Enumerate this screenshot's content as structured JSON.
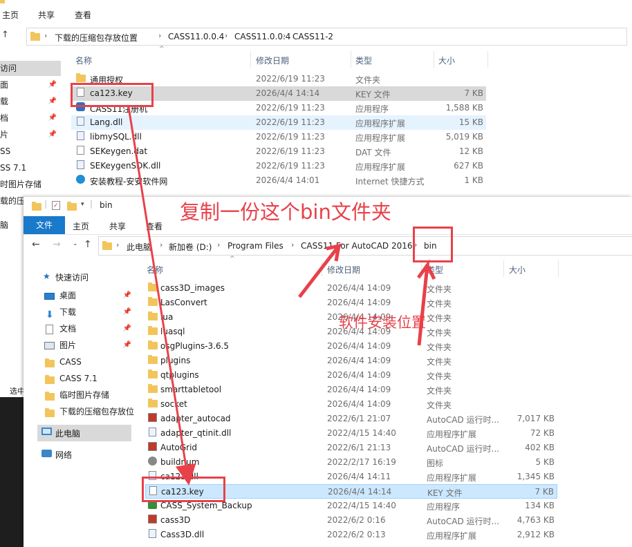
{
  "back_window": {
    "ribbon_tabs": [
      "主页",
      "共享",
      "查看"
    ],
    "breadcrumbs": [
      "下载的压缩包存放位置",
      "CASS11.0.0.4",
      "CASS11.0.0.4",
      "CASS11-2"
    ],
    "columns": {
      "name": "名称",
      "modified": "修改日期",
      "type": "类型",
      "size": "大小"
    },
    "nav_items": [
      "访问",
      "面",
      "载",
      "档",
      "片",
      "SS",
      "SS 7.1",
      "时图片存储",
      "载的压",
      "脑",
      "选中"
    ],
    "files": [
      {
        "name": "通用授权",
        "date": "2022/6/19 11:23",
        "type": "文件夹",
        "size": "",
        "icon": "folder-icon"
      },
      {
        "name": "ca123.key",
        "date": "2026/4/4 14:14",
        "type": "KEY 文件",
        "size": "7 KB",
        "icon": "file-icon"
      },
      {
        "name": "CASS11注册机",
        "date": "2022/6/19 11:23",
        "type": "应用程序",
        "size": "1,588 KB",
        "icon": "app-icon"
      },
      {
        "name": "Lang.dll",
        "date": "2022/6/19 11:23",
        "type": "应用程序扩展",
        "size": "15 KB",
        "icon": "dll-icon"
      },
      {
        "name": "libmySQL.dll",
        "date": "2022/6/19 11:23",
        "type": "应用程序扩展",
        "size": "5,019 KB",
        "icon": "dll-icon"
      },
      {
        "name": "SEKeygen.dat",
        "date": "2022/6/19 11:23",
        "type": "DAT 文件",
        "size": "12 KB",
        "icon": "file-icon"
      },
      {
        "name": "SEKeygenSDK.dll",
        "date": "2022/6/19 11:23",
        "type": "应用程序扩展",
        "size": "627 KB",
        "icon": "dll-icon"
      },
      {
        "name": "安装教程-安安软件网",
        "date": "2026/4/4 14:01",
        "type": "Internet 快捷方式",
        "size": "1 KB",
        "icon": "web-icon"
      }
    ]
  },
  "front_window": {
    "title": "bin",
    "ribbon_tabs": {
      "file": "文件",
      "home": "主页",
      "share": "共享",
      "view": "查看"
    },
    "breadcrumbs": [
      "此电脑",
      "新加卷 (D:)",
      "Program Files",
      "CASS11 For AutoCAD 2016",
      "bin"
    ],
    "columns": {
      "name": "名称",
      "modified": "修改日期",
      "type": "类型",
      "size": "大小"
    },
    "nav": {
      "quick_access": "快速访问",
      "items": [
        {
          "label": "桌面",
          "icon": "desktop-icon",
          "pinned": true
        },
        {
          "label": "下载",
          "icon": "download-icon",
          "pinned": true
        },
        {
          "label": "文档",
          "icon": "document-icon",
          "pinned": true
        },
        {
          "label": "图片",
          "icon": "picture-icon",
          "pinned": true
        },
        {
          "label": "CASS",
          "icon": "folder-icon",
          "pinned": false
        },
        {
          "label": "CASS 7.1",
          "icon": "folder-icon",
          "pinned": false
        },
        {
          "label": "临时图片存储",
          "icon": "folder-icon",
          "pinned": false
        },
        {
          "label": "下载的压缩包存放位",
          "icon": "folder-icon",
          "pinned": false
        }
      ],
      "this_pc": "此电脑",
      "network": "网络"
    },
    "files": [
      {
        "name": "cass3D_images",
        "date": "2026/4/4 14:09",
        "type": "文件夹",
        "size": "",
        "icon": "folder-icon"
      },
      {
        "name": "LasConvert",
        "date": "2026/4/4 14:09",
        "type": "文件夹",
        "size": "",
        "icon": "folder-icon"
      },
      {
        "name": "lua",
        "date": "2026/4/4 14:09",
        "type": "文件夹",
        "size": "",
        "icon": "folder-icon"
      },
      {
        "name": "luasql",
        "date": "2026/4/4 14:09",
        "type": "文件夹",
        "size": "",
        "icon": "folder-icon"
      },
      {
        "name": "osgPlugins-3.6.5",
        "date": "2026/4/4 14:09",
        "type": "文件夹",
        "size": "",
        "icon": "folder-icon"
      },
      {
        "name": "plugins",
        "date": "2026/4/4 14:09",
        "type": "文件夹",
        "size": "",
        "icon": "folder-icon"
      },
      {
        "name": "qtplugins",
        "date": "2026/4/4 14:09",
        "type": "文件夹",
        "size": "",
        "icon": "folder-icon"
      },
      {
        "name": "smarttabletool",
        "date": "2026/4/4 14:09",
        "type": "文件夹",
        "size": "",
        "icon": "folder-icon"
      },
      {
        "name": "socket",
        "date": "2026/4/4 14:09",
        "type": "文件夹",
        "size": "",
        "icon": "folder-icon"
      },
      {
        "name": "adapter_autocad",
        "date": "2022/6/1 21:07",
        "type": "AutoCAD 运行时...",
        "size": "7,017 KB",
        "icon": "arx-icon"
      },
      {
        "name": "adapter_qtinit.dll",
        "date": "2022/4/15 14:40",
        "type": "应用程序扩展",
        "size": "72 KB",
        "icon": "dll-icon"
      },
      {
        "name": "AutoGrid",
        "date": "2022/6/1 21:13",
        "type": "AutoCAD 运行时...",
        "size": "402 KB",
        "icon": "arx-icon"
      },
      {
        "name": "buildnum",
        "date": "2022/2/17 16:19",
        "type": "图标",
        "size": "5 KB",
        "icon": "ico-icon"
      },
      {
        "name": "ca123.dll",
        "date": "2026/4/4 14:11",
        "type": "应用程序扩展",
        "size": "1,345 KB",
        "icon": "dll-icon"
      },
      {
        "name": "ca123.key",
        "date": "2026/4/4 14:14",
        "type": "KEY 文件",
        "size": "7 KB",
        "icon": "file-icon"
      },
      {
        "name": "CASS_System_Backup",
        "date": "2022/4/15 14:40",
        "type": "应用程序",
        "size": "134 KB",
        "icon": "backup-icon"
      },
      {
        "name": "cass3D",
        "date": "2022/6/2 0:16",
        "type": "AutoCAD 运行时...",
        "size": "4,763 KB",
        "icon": "arx-icon"
      },
      {
        "name": "Cass3D.dll",
        "date": "2022/6/2 0:13",
        "type": "应用程序扩展",
        "size": "2,912 KB",
        "icon": "dll-icon"
      }
    ]
  },
  "annotations": {
    "copy_text": "复制一份这个bin文件夹",
    "install_text": "软件安装位置",
    "color": "#e8414a"
  }
}
